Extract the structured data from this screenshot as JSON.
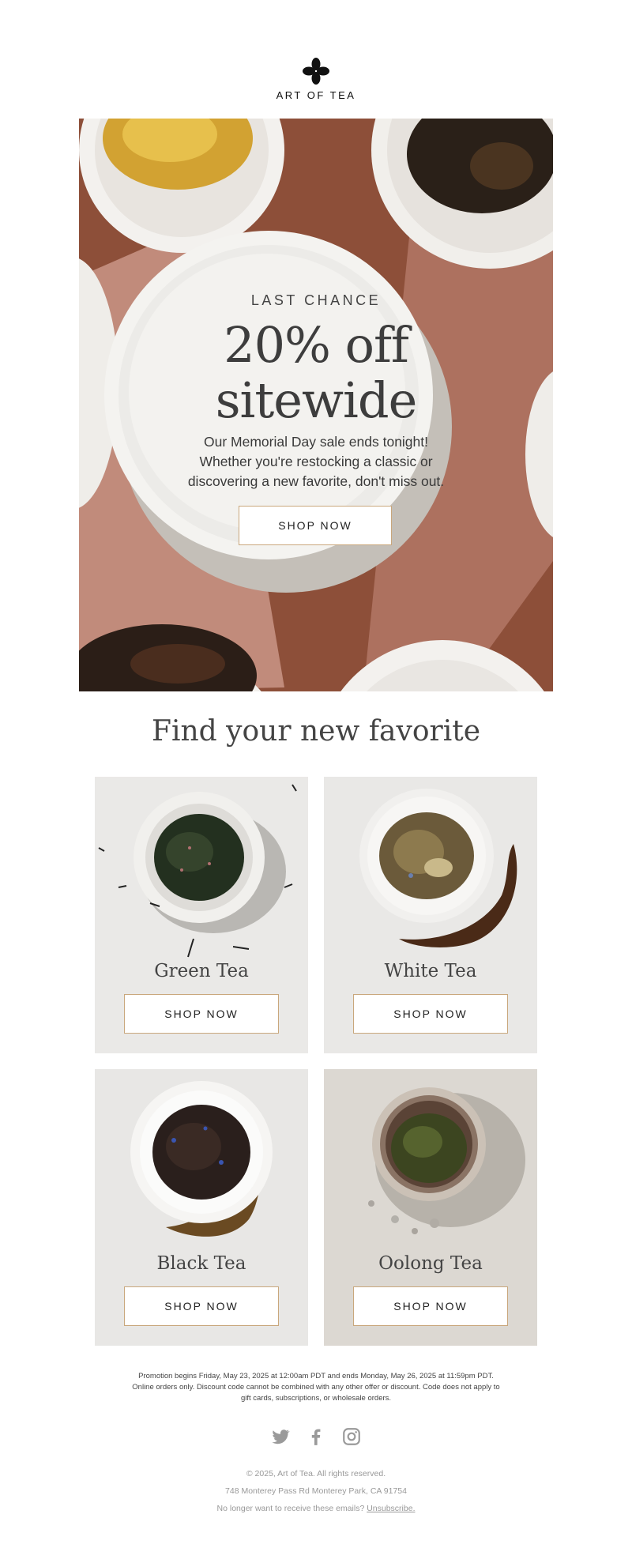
{
  "brand": {
    "name": "ART OF TEA",
    "logo_icon": "four-petal-flower-icon"
  },
  "hero": {
    "eyebrow": "LAST CHANCE",
    "title_line1": "20% off",
    "title_line2": "sitewide",
    "body_line1": "Our Memorial Day sale ends tonight!",
    "body_line2": "Whether you're restocking a classic or",
    "body_line3": "discovering a new favorite, don't miss out.",
    "cta_label": "SHOP NOW"
  },
  "section": {
    "title": "Find your new favorite"
  },
  "products": [
    {
      "name": "Green Tea",
      "cta_label": "SHOP NOW"
    },
    {
      "name": "White Tea",
      "cta_label": "SHOP NOW"
    },
    {
      "name": "Black Tea",
      "cta_label": "SHOP NOW"
    },
    {
      "name": "Oolong Tea",
      "cta_label": "SHOP NOW"
    }
  ],
  "legal": {
    "line1": "Promotion begins Friday, May 23, 2025 at 12:00am PDT and ends Monday, May 26, 2025 at 11:59pm PDT.",
    "line2": "Online orders only. Discount code cannot be combined with any other offer or discount. Code does not apply to",
    "line3": "gift cards, subscriptions, or wholesale orders."
  },
  "socials": [
    {
      "icon": "twitter-icon"
    },
    {
      "icon": "facebook-icon"
    },
    {
      "icon": "instagram-icon"
    }
  ],
  "footer": {
    "copyright": "© 2025, Art of Tea. All rights reserved.",
    "address": "748 Monterey Pass Rd Monterey Park, CA 91754",
    "unsubscribe_prompt": "No longer want to receive these emails?",
    "unsubscribe_label": "Unsubscribe."
  },
  "colors": {
    "accent_border": "#c9a77c",
    "hero_background": "#8b4d37",
    "card_background": "#e9e8e6"
  }
}
